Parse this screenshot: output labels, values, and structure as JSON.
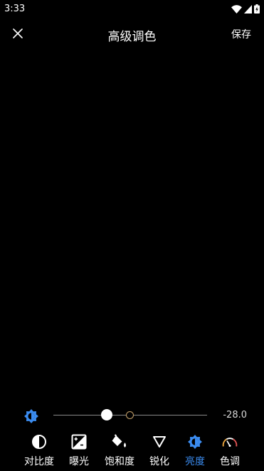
{
  "status_bar": {
    "time": "3:33",
    "icons": [
      "wifi-icon",
      "cellular-signal-icon",
      "battery-charging-icon"
    ]
  },
  "header": {
    "title": "高级调色",
    "close_icon": "close-icon",
    "save_label": "保存"
  },
  "slider": {
    "icon": "brightness-icon",
    "value_label": "-28.0",
    "value": -28.0
  },
  "tools": [
    {
      "id": "contrast",
      "label": "对比度",
      "icon": "contrast-icon",
      "active": false
    },
    {
      "id": "exposure",
      "label": "曝光",
      "icon": "exposure-icon",
      "active": false
    },
    {
      "id": "saturation",
      "label": "饱和度",
      "icon": "saturation-icon",
      "active": false
    },
    {
      "id": "sharpen",
      "label": "锐化",
      "icon": "sharpen-icon",
      "active": false
    },
    {
      "id": "brightness",
      "label": "亮度",
      "icon": "brightness-icon",
      "active": true
    },
    {
      "id": "hue",
      "label": "色调",
      "icon": "hue-gauge-icon",
      "active": false
    }
  ],
  "colors": {
    "accent": "#3b8cf0",
    "background": "#000000",
    "slider_origin": "#c7a26a"
  }
}
